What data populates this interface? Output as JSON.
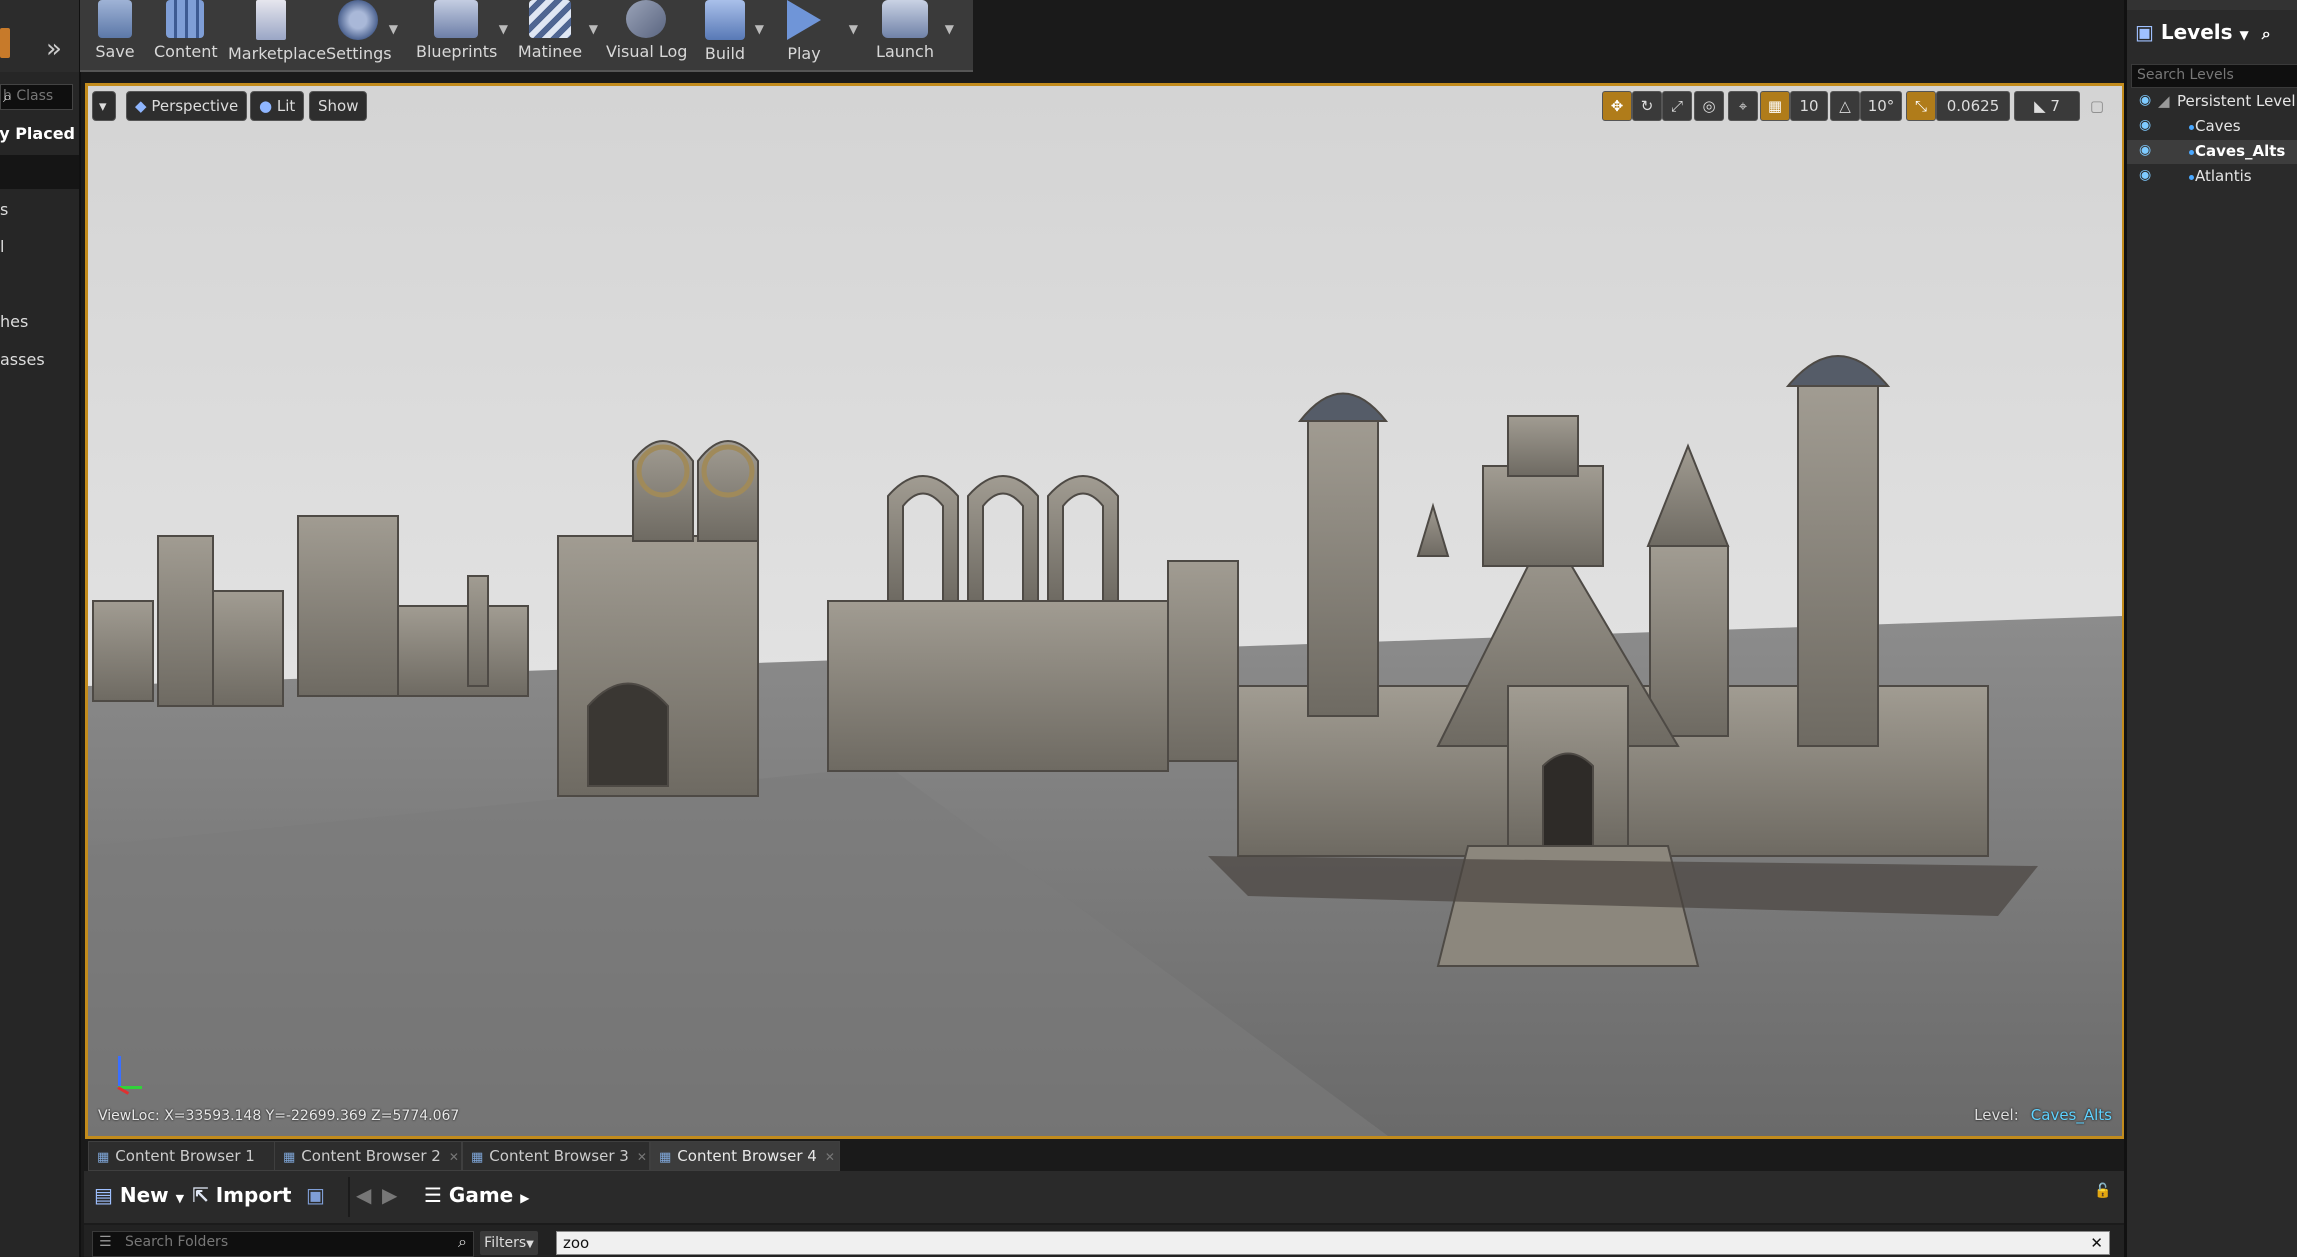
{
  "left_panel": {
    "search_placeholder": "h Class",
    "active_category": "ntly Placed",
    "categories": [
      "s",
      "l",
      "hes",
      "asses"
    ]
  },
  "toolbar": {
    "buttons": [
      {
        "label": "Save",
        "icon": "save-icon"
      },
      {
        "label": "Content",
        "icon": "content-icon"
      },
      {
        "label": "Marketplace",
        "icon": "marketplace-icon"
      },
      {
        "label": "Settings",
        "icon": "settings-icon"
      },
      {
        "label": "Blueprints",
        "icon": "blueprints-icon"
      },
      {
        "label": "Matinee",
        "icon": "matinee-icon"
      },
      {
        "label": "Visual Log",
        "icon": "visual-log-icon"
      },
      {
        "label": "Build",
        "icon": "build-icon"
      },
      {
        "label": "Play",
        "icon": "play-icon"
      },
      {
        "label": "Launch",
        "icon": "launch-icon"
      }
    ]
  },
  "viewport": {
    "view_mode": "Perspective",
    "lighting": "Lit",
    "show": "Show",
    "grid_snap": "10",
    "rotation_snap": "10°",
    "scale_snap": "0.0625",
    "camera_speed": "7",
    "viewloc": "ViewLoc: X=33593.148 Y=-22699.369 Z=5774.067",
    "level_label": "Level:",
    "level_name": "Caves_Alts",
    "accent": "#c28b1c"
  },
  "levels_panel": {
    "title": "Levels",
    "search_placeholder": "Search Levels",
    "levels": [
      {
        "name": "Persistent Level"
      },
      {
        "name": "Caves"
      },
      {
        "name": "Caves_Alts"
      },
      {
        "name": "Atlantis"
      }
    ]
  },
  "content_tabs": [
    {
      "label": "Content Browser 1"
    },
    {
      "label": "Content Browser 2"
    },
    {
      "label": "Content Browser 3"
    },
    {
      "label": "Content Browser 4"
    }
  ],
  "content_browser": {
    "new_label": "New",
    "import_label": "Import",
    "path": "Game",
    "folders_placeholder": "Search Folders",
    "filters_label": "Filters",
    "search_value": "zoo"
  }
}
